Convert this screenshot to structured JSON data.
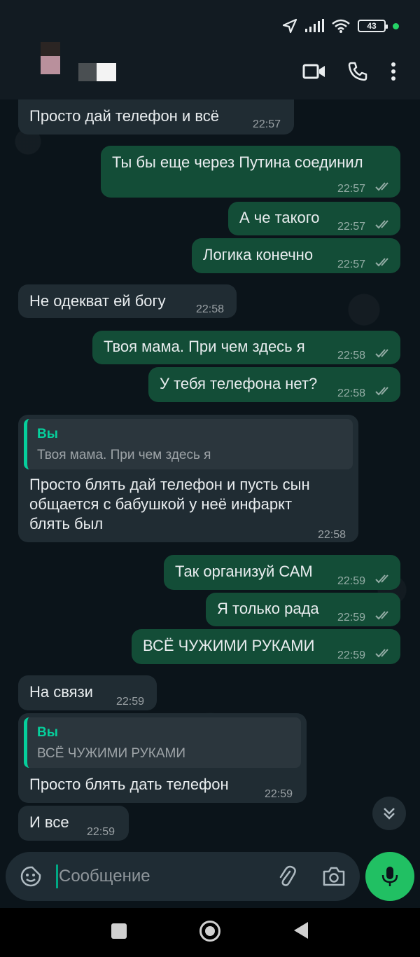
{
  "status_bar": {
    "battery": "43",
    "icons": [
      "location-icon",
      "signal-icon",
      "wifi-icon",
      "battery-icon",
      "notification-dot"
    ]
  },
  "header": {
    "actions": [
      "video-call-icon",
      "phone-icon",
      "more-options-icon"
    ]
  },
  "messages": [
    {
      "dir": "in",
      "text": "Просто дай телефон и всё",
      "time": "22:57"
    },
    {
      "dir": "out",
      "text": "Ты бы еще через Путина соединил",
      "time": "22:57"
    },
    {
      "dir": "out",
      "text": "А че такого",
      "time": "22:57"
    },
    {
      "dir": "out",
      "text": "Логика конечно",
      "time": "22:57"
    },
    {
      "dir": "in",
      "text": "Не одекват ей богу",
      "time": "22:58"
    },
    {
      "dir": "out",
      "text": "Твоя мама. При чем здесь я",
      "time": "22:58"
    },
    {
      "dir": "out",
      "text": "У тебя телефона нет?",
      "time": "22:58"
    },
    {
      "dir": "in",
      "quote_name": "Вы",
      "quote_text": "Твоя мама. При чем здесь я",
      "lines": [
        "Просто блять дай телефон и пусть сын",
        "общается с бабушкой у неё инфаркт",
        "блять был"
      ],
      "time": "22:58"
    },
    {
      "dir": "out",
      "text": "Так организуй САМ",
      "time": "22:59"
    },
    {
      "dir": "out",
      "text": "Я только рада",
      "time": "22:59"
    },
    {
      "dir": "out",
      "text": "ВСЁ ЧУЖИМИ РУКАМИ",
      "time": "22:59"
    },
    {
      "dir": "in",
      "text": "На связи",
      "time": "22:59"
    },
    {
      "dir": "in",
      "quote_name": "Вы",
      "quote_text": "ВСЁ ЧУЖИМИ РУКАМИ",
      "text": "Просто блять дать телефон",
      "time": "22:59"
    },
    {
      "dir": "in",
      "text": "И все",
      "time": "22:59"
    }
  ],
  "input": {
    "placeholder": "Сообщение"
  },
  "colors": {
    "background": "#0b141a",
    "incoming": "#202c33",
    "outgoing": "#134d37",
    "accent": "#21c063"
  }
}
